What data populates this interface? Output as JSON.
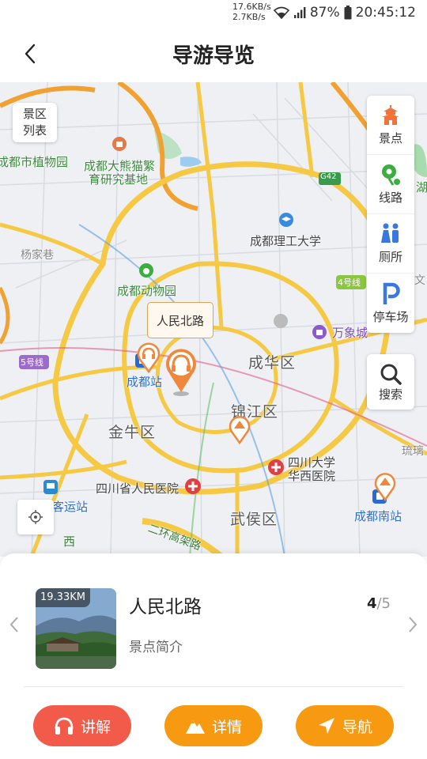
{
  "status_bar": {
    "net_up": "17.6KB/s",
    "net_down": "2.7KB/s",
    "battery": "87%",
    "time": "20:45:12"
  },
  "header": {
    "title": "导游导览"
  },
  "map": {
    "labels": {
      "botanical": "成都市植物园",
      "panda_base_1": "成都大熊猫繁",
      "panda_base_2": "育研究基地",
      "yangjiaxiang": "杨家巷",
      "zoo": "成都动物园",
      "ligong": "成都理工大学",
      "wanxiang": "万象城",
      "line4": "4号线",
      "line5": "5号线",
      "g42": "G42",
      "chengdu_station": "成都站",
      "chenghua": "成华区",
      "jinjiang": "锦江区",
      "jinniu": "金牛区",
      "wuhou": "武侯区",
      "sichuan_hospital": "四川省人民医院",
      "huaxi_1": "四川大学",
      "huaxi_2": "华西医院",
      "bus_station": "客运站",
      "south_station": "成都南站",
      "erhuan": "二环高架路",
      "liuli": "琉璃",
      "lake": "湖",
      "wen": "文",
      "xi": "西"
    },
    "callout": "人民北路",
    "list_button": [
      "景区",
      "列表"
    ],
    "tools": [
      {
        "label": "景点",
        "icon": "pagoda-icon",
        "color": "#f0743a"
      },
      {
        "label": "线路",
        "icon": "route-icon",
        "color": "#3bae3f"
      },
      {
        "label": "厕所",
        "icon": "toilet-icon",
        "color": "#3a78e0"
      },
      {
        "label": "停车场",
        "icon": "parking-icon",
        "color": "#3a78e0"
      }
    ],
    "search_label": "搜索"
  },
  "card": {
    "distance": "19.33KM",
    "name": "人民北路",
    "intro": "景点简介",
    "current": "4",
    "total": "/5",
    "buttons": {
      "listen": "讲解",
      "detail": "详情",
      "navigate": "导航"
    }
  },
  "colors": {
    "accent_orange": "#f79a12",
    "accent_red": "#f25a4a",
    "road_yellow": "#f6c945"
  }
}
